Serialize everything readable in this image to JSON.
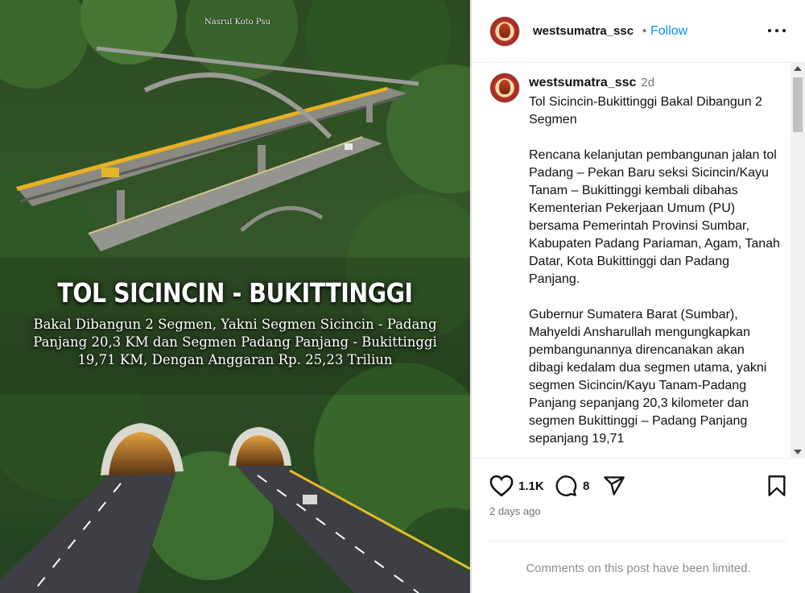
{
  "post": {
    "image_credit": "Nasrul Koto Psu",
    "headline": "TOL SICINCIN - BUKITTINGGI",
    "subline": "Bakal Dibangun 2 Segmen, Yakni Segmen Sicincin - Padang Panjang 20,3 KM dan Segmen Padang Panjang  - Bukittinggi 19,71 KM, Dengan Anggaran Rp. 25,23 Triliun"
  },
  "header": {
    "username": "westsumatra_ssc",
    "separator": "•",
    "follow_label": "Follow",
    "more_icon": "more-horizontal-icon"
  },
  "caption": {
    "username": "westsumatra_ssc",
    "age": "2d",
    "text": "Tol Sicincin-Bukittinggi Bakal Dibangun 2 Segmen\n\nRencana kelanjutan pembangunan jalan tol Padang – Pekan Baru seksi Sicincin/Kayu Tanam – Bukittinggi kembali dibahas Kementerian Pekerjaan Umum (PU) bersama Pemerintah Provinsi Sumbar, Kabupaten Padang Pariaman, Agam, Tanah Datar, Kota Bukittinggi dan Padang Panjang.\n\nGubernur Sumatera Barat (Sumbar), Mahyeldi Ansharullah mengungkapkan pembangunannya direncanakan akan dibagi kedalam dua segmen utama, yakni segmen Sicincin/Kayu Tanam-Padang Panjang sepanjang 20,3 kilometer dan segmen Bukittinggi – Padang Panjang sepanjang 19,71"
  },
  "actions": {
    "likes": "1.1K",
    "comments": "8",
    "posted": "2 days ago",
    "limited_notice": "Comments on this post have been limited.",
    "icons": [
      "heart-icon",
      "comment-icon",
      "share-icon",
      "bookmark-icon"
    ]
  }
}
